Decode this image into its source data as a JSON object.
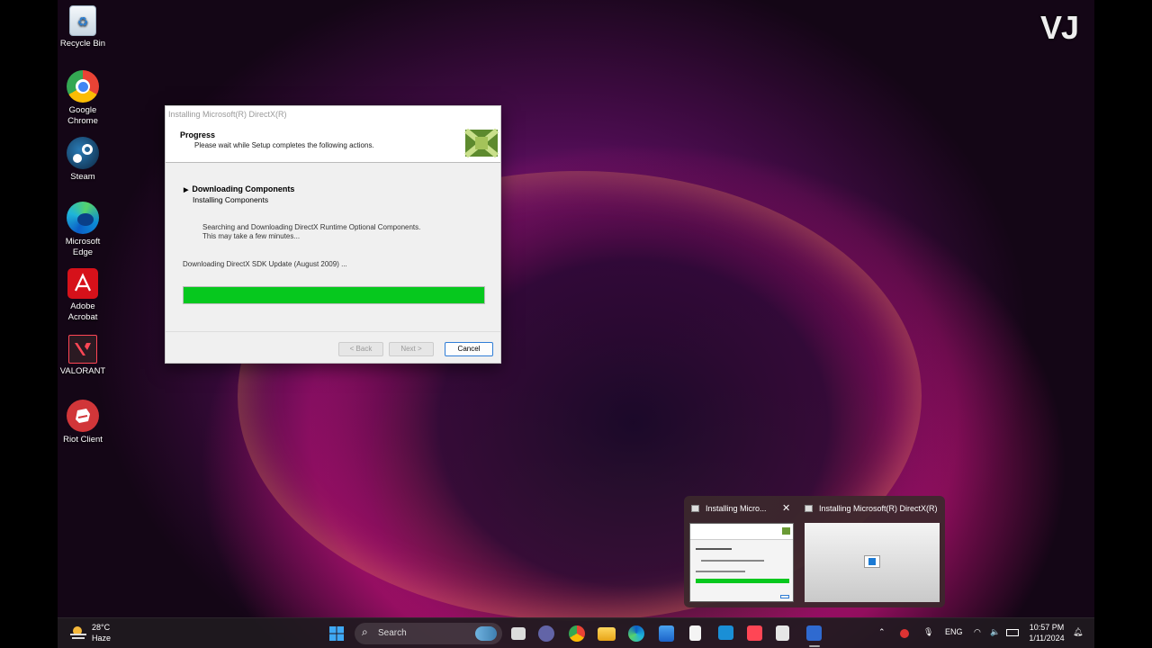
{
  "desktop": {
    "icons": [
      {
        "label": "Recycle Bin",
        "icon": "recycle-bin-icon"
      },
      {
        "label": "Google Chrome",
        "icon": "chrome-icon"
      },
      {
        "label": "Steam",
        "icon": "steam-icon"
      },
      {
        "label": "Microsoft Edge",
        "icon": "edge-icon"
      },
      {
        "label": "Adobe Acrobat",
        "icon": "acrobat-icon"
      },
      {
        "label": "VALORANT",
        "icon": "valorant-icon"
      },
      {
        "label": "Riot Client",
        "icon": "riot-client-icon"
      }
    ],
    "watermark": "VJ"
  },
  "dialog": {
    "window_title": "Installing Microsoft(R) DirectX(R)",
    "header_title": "Progress",
    "header_subtitle": "Please wait while Setup completes the following actions.",
    "step_title": "Downloading Components",
    "step_subtitle": "Installing Components",
    "desc_line1": "Searching and Downloading DirectX Runtime Optional Components.",
    "desc_line2": "This may take a few minutes...",
    "status": "Downloading DirectX SDK Update (August 2009) ...",
    "progress_percent": 100,
    "progress_color": "#06c81e",
    "back_label": "< Back",
    "next_label": "Next >",
    "cancel_label": "Cancel"
  },
  "preview": {
    "item1_title": "Installing Micro...",
    "item2_title": "Installing Microsoft(R) DirectX(R)"
  },
  "taskbar": {
    "weather_temp": "28°C",
    "weather_desc": "Haze",
    "search_label": "Search",
    "lang": "ENG",
    "time": "10:57 PM",
    "date": "1/11/2024"
  }
}
